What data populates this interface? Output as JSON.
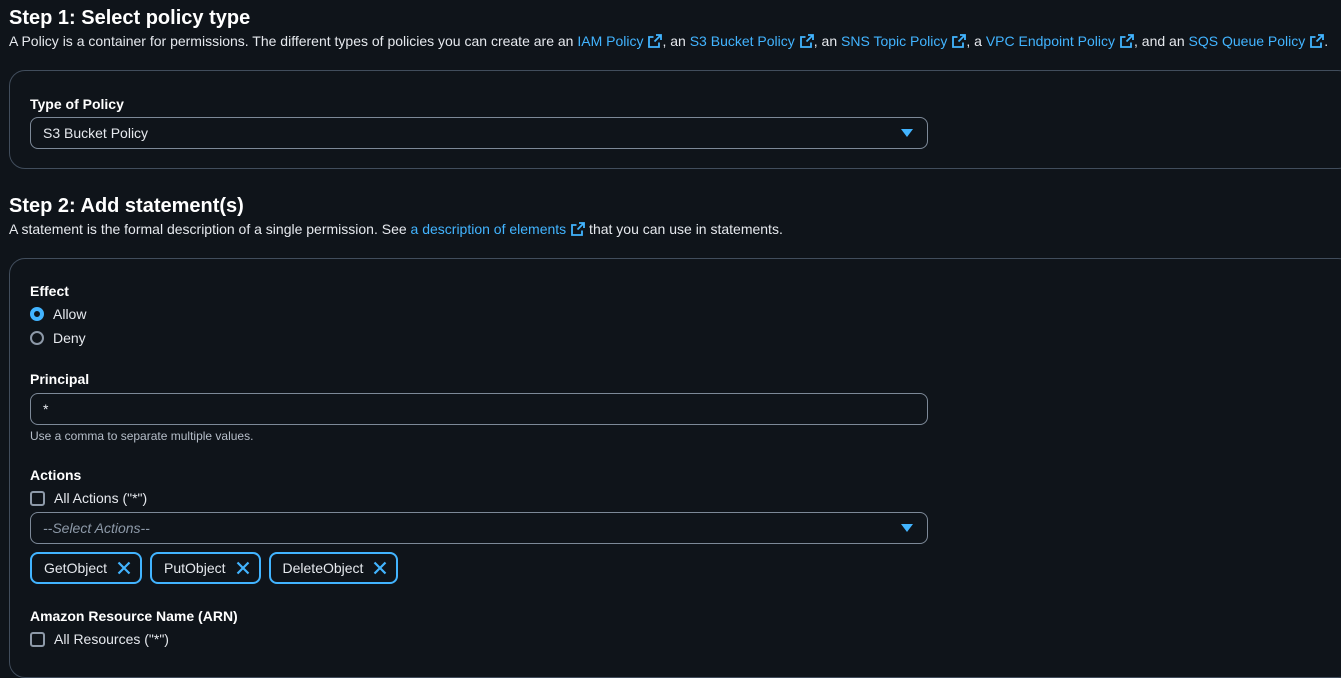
{
  "step1": {
    "title": "Step 1: Select policy type",
    "desc_prefix": "A Policy is a container for permissions. The different types of policies you can create are an ",
    "link_iam": "IAM Policy",
    "sep1": ", an ",
    "link_s3": "S3 Bucket Policy",
    "sep2": ", an ",
    "link_sns": "SNS Topic Policy",
    "sep3": ", a ",
    "link_vpc": "VPC Endpoint Policy",
    "sep4": ", and an ",
    "link_sqs": "SQS Queue Policy",
    "desc_suffix": ".",
    "type_label": "Type of Policy",
    "type_value": "S3 Bucket Policy"
  },
  "step2": {
    "title": "Step 2: Add statement(s)",
    "desc_prefix": "A statement is the formal description of a single permission. See ",
    "desc_link": "a description of elements",
    "desc_suffix": " that you can use in statements."
  },
  "effect": {
    "label": "Effect",
    "options": [
      "Allow",
      "Deny"
    ],
    "selected": "Allow"
  },
  "principal": {
    "label": "Principal",
    "value": "*",
    "hint": "Use a comma to separate multiple values."
  },
  "actions": {
    "label": "Actions",
    "all_label": "All Actions (\"*\")",
    "select_placeholder": "--Select Actions--",
    "tokens": [
      "GetObject",
      "PutObject",
      "DeleteObject"
    ]
  },
  "arn": {
    "label": "Amazon Resource Name (ARN)",
    "all_label": "All Resources (\"*\")"
  },
  "icons": {
    "external_link": "external-link-icon",
    "dismiss": "close-icon",
    "caret": "caret-down-icon"
  },
  "colors": {
    "background": "#0f141a",
    "link": "#42b4ff",
    "border": "#414d5c",
    "accent": "#42b4ff"
  }
}
